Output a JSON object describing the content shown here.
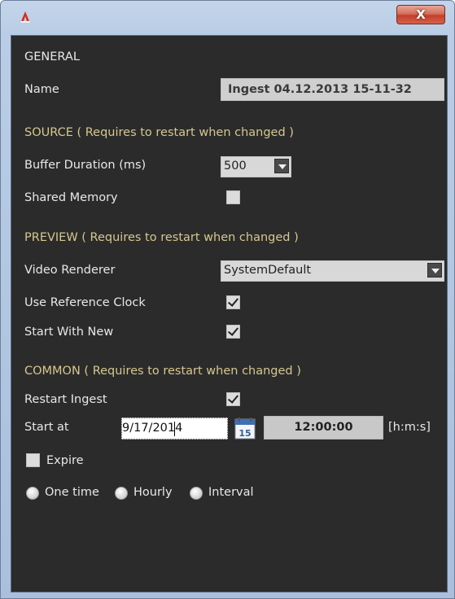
{
  "window": {
    "close_glyph": "X",
    "app_icon": "app-logo-icon"
  },
  "general": {
    "header": "GENERAL",
    "name_label": "Name",
    "name_value": "Ingest 04.12.2013 15-11-32"
  },
  "source": {
    "header": "SOURCE ( Requires to restart when changed )",
    "buffer_label": "Buffer Duration (ms)",
    "buffer_value": "500",
    "shared_memory_label": "Shared Memory",
    "shared_memory_checked": false
  },
  "preview": {
    "header": "PREVIEW ( Requires to restart when changed )",
    "renderer_label": "Video Renderer",
    "renderer_value": "SystemDefault",
    "ref_clock_label": "Use Reference Clock",
    "ref_clock_checked": true,
    "start_new_label": "Start With New",
    "start_new_checked": true
  },
  "common": {
    "header": "COMMON ( Requires to restart when changed )",
    "restart_label": "Restart Ingest",
    "restart_checked": true,
    "start_at_label": "Start at",
    "date_value": "9/17/2014",
    "calendar_day": "15",
    "time_value": "12:00:00",
    "time_format": "[h:m:s]",
    "expire_label": "Expire",
    "expire_checked": false,
    "radio_one_time": "One time",
    "radio_hourly": "Hourly",
    "radio_interval": "Interval"
  },
  "colors": {
    "panel_bg": "#2b2b2b",
    "section_text": "#d6c78e",
    "label_text": "#e8e8e8"
  }
}
